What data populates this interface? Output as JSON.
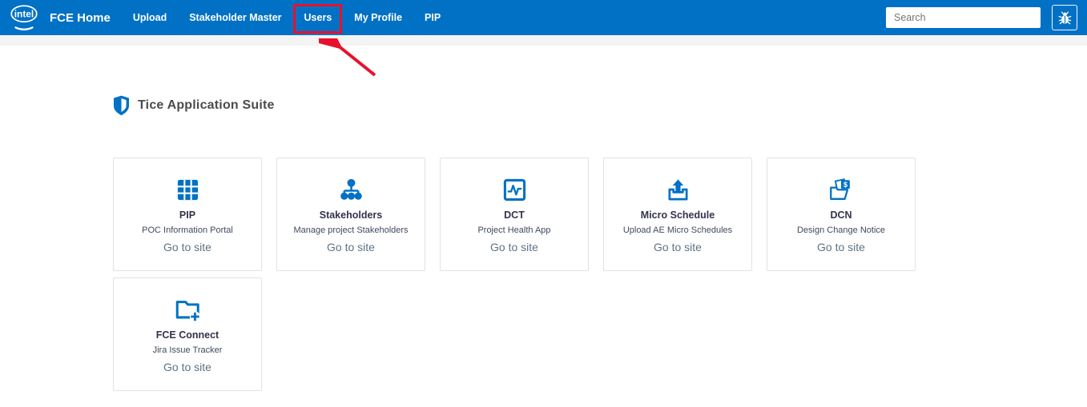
{
  "navbar": {
    "brand": "FCE Home",
    "items": [
      {
        "label": "Upload"
      },
      {
        "label": "Stakeholder Master"
      },
      {
        "label": "Users",
        "highlighted": true
      },
      {
        "label": "My Profile"
      },
      {
        "label": "PIP"
      }
    ],
    "search": {
      "placeholder": "Search"
    }
  },
  "section": {
    "title": "Tice Application Suite"
  },
  "cards": [
    {
      "title": "PIP",
      "subtitle": "POC Information Portal",
      "link": "Go to site",
      "icon": "grid-icon"
    },
    {
      "title": "Stakeholders",
      "subtitle": "Manage project Stakeholders",
      "link": "Go to site",
      "icon": "sitemap-icon"
    },
    {
      "title": "DCT",
      "subtitle": "Project Health App",
      "link": "Go to site",
      "icon": "pulse-chart-icon"
    },
    {
      "title": "Micro Schedule",
      "subtitle": "Upload AE Micro Schedules",
      "link": "Go to site",
      "icon": "upload-icon"
    },
    {
      "title": "DCN",
      "subtitle": "Design Change Notice",
      "link": "Go to site",
      "icon": "folder-invoice-icon"
    },
    {
      "title": "FCE Connect",
      "subtitle": "Jira Issue Tracker",
      "link": "Go to site",
      "icon": "folder-plus-icon"
    }
  ],
  "annotation": {
    "type": "red-box-with-arrow",
    "target": "Users"
  },
  "colors": {
    "nav_blue": "#0071C5",
    "icon_blue": "#0071C5",
    "annotation_red": "#E8112D",
    "card_title": "#33334D",
    "card_subtitle": "#3F4A5F",
    "card_link": "#5E7385"
  }
}
